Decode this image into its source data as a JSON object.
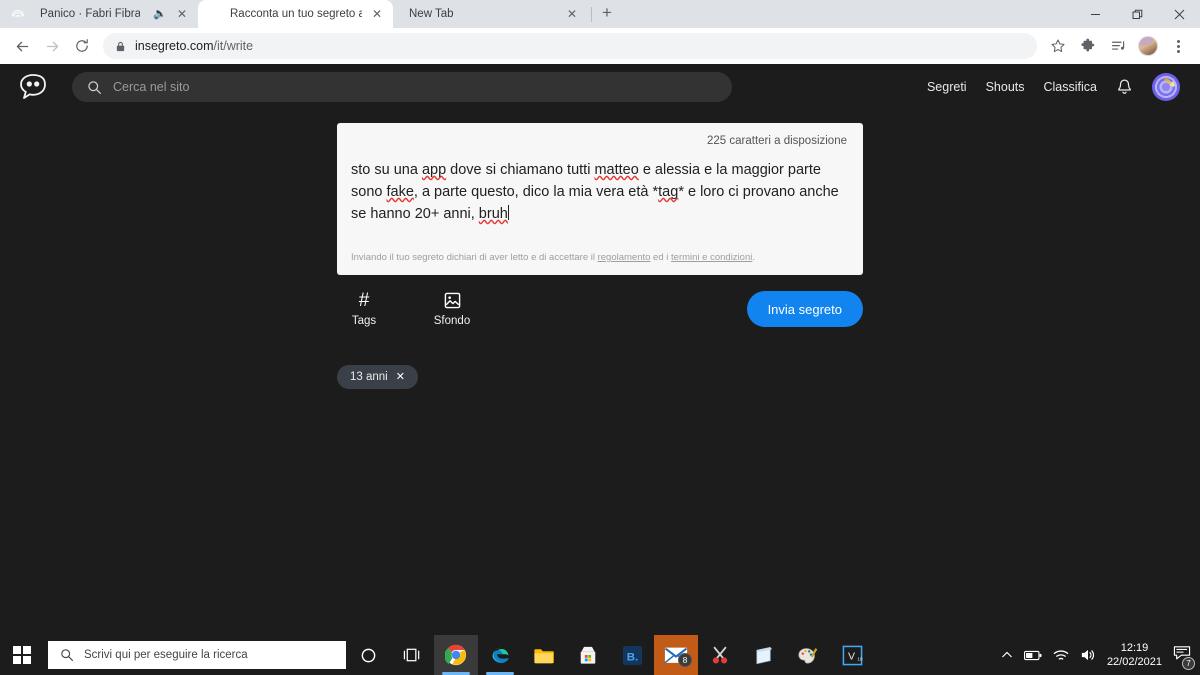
{
  "browser": {
    "tabs": [
      {
        "title": "Panico · Fabri Fibra, Neffa",
        "favicon": "spotify-icon",
        "audio": true,
        "active": false
      },
      {
        "title": "Racconta un tuo segreto anonim",
        "favicon": "insegreto-bubble-icon",
        "audio": false,
        "active": true
      },
      {
        "title": "New Tab",
        "favicon": "none",
        "audio": false,
        "active": false
      }
    ],
    "new_tab_label": "+",
    "url_domain": "insegreto.com",
    "url_path": "/it/write",
    "window_controls": {
      "minimize": "minimize-icon",
      "restore": "restore-icon",
      "close": "close-icon"
    },
    "toolbar_icons": [
      "back-icon",
      "forward-icon",
      "reload-icon",
      "lock-icon",
      "bookmark-star-icon",
      "extensions-puzzle-icon",
      "media-list-icon",
      "profile-avatar",
      "chrome-menu-icon"
    ]
  },
  "site": {
    "logo_name": "insegreto-logo",
    "search": {
      "placeholder": "Cerca nel sito",
      "value": ""
    },
    "nav": [
      {
        "label": "Segreti"
      },
      {
        "label": "Shouts"
      },
      {
        "label": "Classifica"
      }
    ],
    "bell_icon": "notifications-bell-icon",
    "avatar_name": "user-avatar-dartboard"
  },
  "composer": {
    "char_count": "225 caratteri a disposizione",
    "secret_parts": [
      {
        "t": "sto su una ",
        "sp": false
      },
      {
        "t": "app",
        "sp": true
      },
      {
        "t": " dove si chiamano tutti ",
        "sp": false
      },
      {
        "t": "matteo",
        "sp": true
      },
      {
        "t": " e alessia e la maggior parte sono ",
        "sp": false
      },
      {
        "t": "fake",
        "sp": true
      },
      {
        "t": ", a parte questo, dico la mia vera età *",
        "sp": false
      },
      {
        "t": "tag",
        "sp": true
      },
      {
        "t": "* e loro ci provano anche se hanno 20+ anni, ",
        "sp": false
      },
      {
        "t": "bruh",
        "sp": true
      }
    ],
    "secret_plain": "sto su una app dove si chiamano tutti matteo e alessia e la maggior parte sono fake, a parte questo, dico la mia vera età *tag* e loro ci provano anche se hanno 20+ anni, bruh",
    "disclaimer": {
      "prefix": "Inviando il tuo segreto dichiari di aver letto e di accettare il ",
      "link1": "regolamento",
      "middle": " ed i ",
      "link2": "termini e condizioni",
      "suffix": "."
    },
    "actions": {
      "tags_label": "Tags",
      "tags_icon": "hash-icon",
      "background_label": "Sfondo",
      "background_icon": "image-icon",
      "submit_label": "Invia segreto",
      "submit_color": "#1184f0"
    },
    "tags": [
      {
        "label": "13 anni",
        "remove_icon": "close-icon"
      }
    ]
  },
  "taskbar": {
    "start_icon": "windows-start-icon",
    "search_placeholder": "Scrivi qui per eseguire la ricerca",
    "cortana_icon": "cortana-circle-icon",
    "taskview_icon": "task-view-icon",
    "apps": [
      {
        "name": "chrome-icon",
        "running": true
      },
      {
        "name": "edge-icon",
        "running": true
      },
      {
        "name": "file-explorer-icon",
        "running": false
      },
      {
        "name": "microsoft-store-icon",
        "running": false
      },
      {
        "name": "bluestacks-icon",
        "running": false,
        "letter": "B."
      },
      {
        "name": "mail-icon",
        "running": false,
        "badge": "8"
      },
      {
        "name": "snipping-tool-icon",
        "running": false
      },
      {
        "name": "sticky-notes-icon",
        "running": false
      },
      {
        "name": "paint-icon",
        "running": false
      },
      {
        "name": "vsdc-editor-icon",
        "running": false,
        "letter": "V"
      }
    ],
    "tray": {
      "chevron_icon": "show-hidden-icons-icon",
      "battery_icon": "battery-icon",
      "wifi_icon": "wifi-icon",
      "volume_icon": "volume-icon",
      "time": "12:19",
      "date": "22/02/2021",
      "notification_icon": "action-center-icon",
      "notification_badge": "7"
    }
  }
}
